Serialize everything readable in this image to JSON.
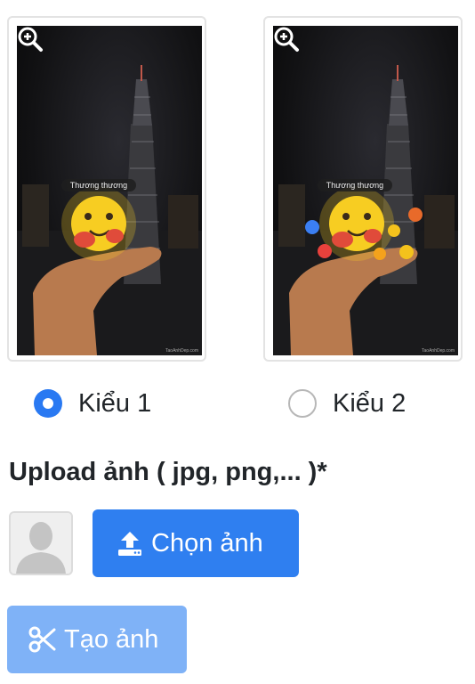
{
  "styles": [
    {
      "bubble_text": "Thương thương",
      "watermark": "TaoAnhDep.com",
      "option_label": "Kiểu 1",
      "selected": true,
      "preview_icon": "zoom-in-icon"
    },
    {
      "bubble_text": "Thương thương",
      "watermark": "TaoAnhDep.com",
      "option_label": "Kiểu 2",
      "selected": false,
      "preview_icon": "zoom-in-icon"
    }
  ],
  "upload": {
    "title": "Upload ảnh ( jpg, png,... )*",
    "avatar_icon": "avatar-placeholder-icon",
    "choose_button_label": "Chọn ảnh",
    "choose_button_icon": "upload-icon"
  },
  "create_button": {
    "label": "Tạo ảnh",
    "icon": "scissors-icon",
    "disabled": true
  },
  "colors": {
    "primary": "#2f7ff0",
    "primary_disabled": "#7fb2f7",
    "radio_selected": "#2979f2",
    "radio_border": "#b7b7b7",
    "text": "#212529"
  }
}
